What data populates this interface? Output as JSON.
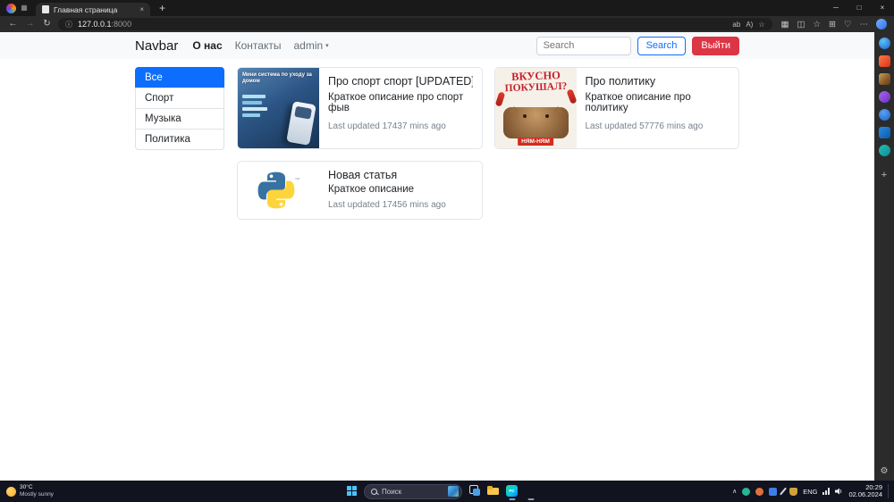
{
  "browser": {
    "tab_title": "Главная страница",
    "url_host": "127.0.0.1",
    "url_port": ":8000"
  },
  "page": {
    "navbar": {
      "brand": "Navbar",
      "link_about": "О нас",
      "link_contacts": "Контакты",
      "link_admin": "admin",
      "search_placeholder": "Search",
      "search_button": "Search",
      "logout_button": "Выйти"
    },
    "categories": [
      {
        "label": "Все"
      },
      {
        "label": "Спорт"
      },
      {
        "label": "Музыка"
      },
      {
        "label": "Политика"
      }
    ],
    "cards": [
      {
        "title": "Про спорт спорт [UPDATED]",
        "description": "Краткое описание про спорт фыв",
        "updated": "Last updated 17437 mins ago",
        "image_caption": "Мини система по уходу за домом"
      },
      {
        "title": "Про политику",
        "description": "Краткое описание про политику",
        "updated": "Last updated 57776 mins ago",
        "image_line1": "ВКУСНО",
        "image_line2": "ПОКУШАЛ?",
        "image_badge": "НЯМ-НЯМ"
      },
      {
        "title": "Новая статья",
        "description": "Краткое описание",
        "updated": "Last updated 17456 mins ago",
        "image_trademark": "™"
      }
    ]
  },
  "taskbar": {
    "weather_temp": "30°C",
    "weather_desc": "Mostly sunny",
    "search_text": "Поиск",
    "language": "ENG",
    "time": "20:29",
    "date": "02.06.2024"
  },
  "icons": {
    "tab_actions": "▦",
    "back": "←",
    "forward": "→",
    "refresh": "↻",
    "site_info": "ⓘ",
    "translate": "ab",
    "read_aloud": "A)",
    "favorite_star": "☆",
    "extensions": "▦",
    "split_screen": "◫",
    "favorites": "☆",
    "collections": "⊞",
    "browser_essentials": "♡",
    "more": "⋯",
    "new_tab": "+",
    "tab_close": "×",
    "minimize": "─",
    "maximize": "□",
    "close": "×",
    "caret_down": "▾",
    "hidden_icons": "∧",
    "rail_add": "+",
    "settings_gear": "⚙"
  },
  "colors": {
    "accent": "#0d6efd",
    "danger": "#dc3545"
  }
}
